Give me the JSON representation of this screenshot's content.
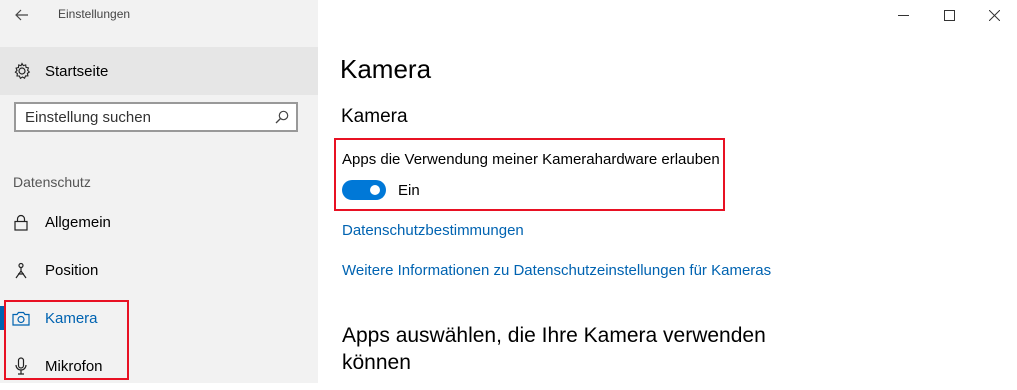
{
  "window": {
    "title": "Einstellungen"
  },
  "sidebar": {
    "home_label": "Startseite",
    "search_placeholder": "Einstellung suchen",
    "section_label": "Datenschutz",
    "items": [
      {
        "label": "Allgemein",
        "icon": "lock-icon"
      },
      {
        "label": "Position",
        "icon": "location-icon"
      },
      {
        "label": "Kamera",
        "icon": "camera-icon",
        "active": true
      },
      {
        "label": "Mikrofon",
        "icon": "microphone-icon"
      }
    ]
  },
  "main": {
    "page_title": "Kamera",
    "section_title": "Kamera",
    "toggle_description": "Apps die Verwendung meiner Kamerahardware erlauben",
    "toggle_state": "Ein",
    "toggle_on": true,
    "link_privacy": "Datenschutzbestimmungen",
    "link_more_info": "Weitere Informationen zu Datenschutzeinstellungen für Kameras",
    "apps_heading": "Apps auswählen, die Ihre Kamera verwenden können"
  },
  "colors": {
    "accent": "#0078d7",
    "link": "#0063b1",
    "highlight_box": "#e81123",
    "sidebar_bg": "#f2f2f2"
  }
}
